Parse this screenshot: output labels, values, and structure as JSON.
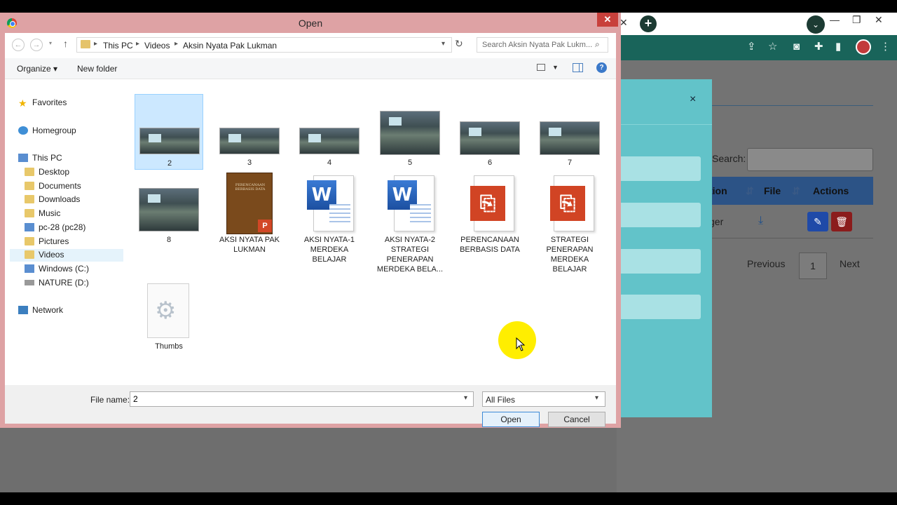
{
  "dialog": {
    "title": "Open",
    "close": "✕",
    "breadcrumb": [
      "This PC",
      "Videos",
      "Aksin Nyata Pak Lukman"
    ],
    "search_placeholder": "Search Aksin Nyata Pak Lukm...",
    "organize": "Organize ▾",
    "new_folder": "New folder",
    "help": "?",
    "nav": {
      "favorites": "Favorites",
      "homegroup": "Homegroup",
      "this_pc": "This PC",
      "desktop": "Desktop",
      "documents": "Documents",
      "downloads": "Downloads",
      "music": "Music",
      "pc28": "pc-28 (pc28)",
      "pictures": "Pictures",
      "videos": "Videos",
      "windows_c": "Windows (C:)",
      "nature_d": "NATURE (D:)",
      "network": "Network"
    },
    "files": [
      {
        "label": "2"
      },
      {
        "label": "3"
      },
      {
        "label": "4"
      },
      {
        "label": "5"
      },
      {
        "label": "6"
      },
      {
        "label": "7"
      },
      {
        "label": "8"
      },
      {
        "label": "AKSI NYATA PAK LUKMAN"
      },
      {
        "label": "AKSI NYATA-1 MERDEKA BELAJAR"
      },
      {
        "label": "AKSI NYATA-2 STRATEGI PENERAPAN MERDEKA BELA..."
      },
      {
        "label": "PERENCANAAN BERBASIS DATA"
      },
      {
        "label": "STRATEGI PENERAPAN MERDEKA BELAJAR"
      },
      {
        "label": "Thumbs"
      }
    ],
    "book_cover_text": "PERENCANAAN BERBASIS DATA",
    "file_name_label": "File name:",
    "file_name_value": "2",
    "file_type": "All Files",
    "open_label": "Open",
    "cancel_label": "Cancel"
  },
  "browser": {
    "tab_close": "✕",
    "new_tab": "+",
    "table": {
      "search_label": "Search:",
      "headers": [
        "tion",
        "File",
        "Actions"
      ],
      "row_text": "ger",
      "previous": "Previous",
      "page": "1",
      "next": "Next"
    },
    "modal_close": "×"
  },
  "colors": {
    "dialog_frame": "#dea2a4",
    "chrome_teal": "#19645a",
    "modal_bg": "#62c3c9",
    "cursor_highlight": "#ffee00"
  }
}
